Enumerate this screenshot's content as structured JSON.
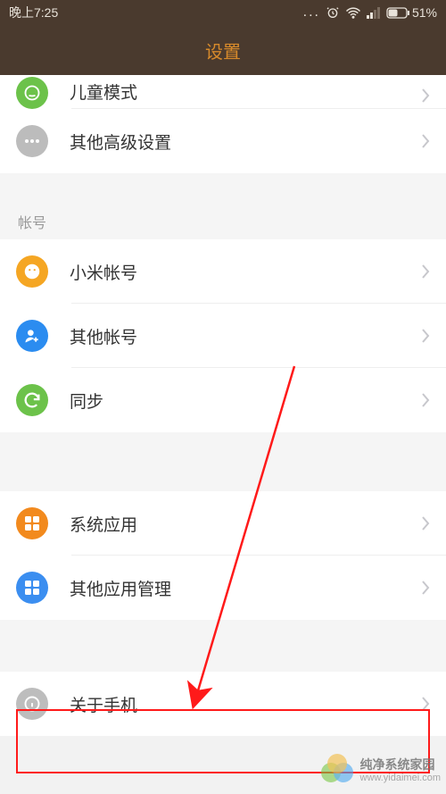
{
  "statusbar": {
    "time": "晚上7:25",
    "battery": "51%"
  },
  "header": {
    "title": "设置"
  },
  "section1": {
    "items": [
      {
        "label": "儿童模式"
      },
      {
        "label": "其他高级设置"
      }
    ]
  },
  "section2": {
    "title": "帐号",
    "items": [
      {
        "label": "小米帐号"
      },
      {
        "label": "其他帐号"
      },
      {
        "label": "同步"
      }
    ]
  },
  "section3": {
    "items": [
      {
        "label": "系统应用"
      },
      {
        "label": "其他应用管理"
      }
    ]
  },
  "section4": {
    "items": [
      {
        "label": "关于手机"
      }
    ]
  },
  "watermark": {
    "main": "纯净系统家园",
    "sub": "www.yidaimei.com"
  }
}
